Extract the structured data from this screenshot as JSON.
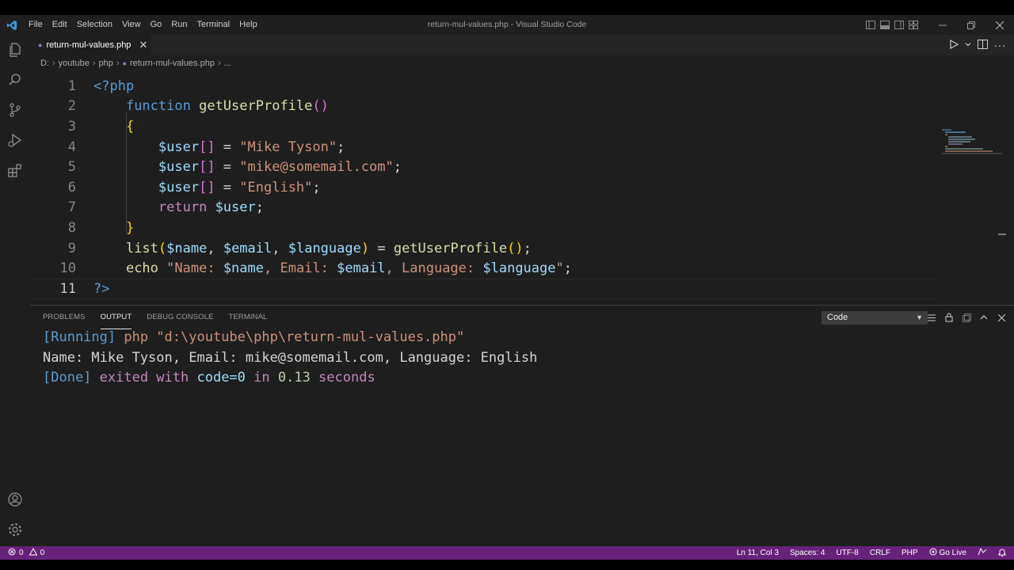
{
  "window": {
    "title": "return-mul-values.php - Visual Studio Code"
  },
  "menu": [
    "File",
    "Edit",
    "Selection",
    "View",
    "Go",
    "Run",
    "Terminal",
    "Help"
  ],
  "tab": {
    "icon": "php-file-icon",
    "label": "return-mul-values.php"
  },
  "breadcrumb": [
    "D:",
    "youtube",
    "php",
    "return-mul-values.php",
    "..."
  ],
  "editor": {
    "active_line": 11,
    "lines": [
      [
        [
          "tag",
          "<?php"
        ]
      ],
      [
        [
          "pl",
          "    "
        ],
        [
          "kw",
          "function"
        ],
        [
          "pl",
          " "
        ],
        [
          "fn",
          "getUserProfile"
        ],
        [
          "br2",
          "()"
        ]
      ],
      [
        [
          "pl",
          "    "
        ],
        [
          "br",
          "{"
        ]
      ],
      [
        [
          "pl",
          "        "
        ],
        [
          "var",
          "$user"
        ],
        [
          "br2",
          "[]"
        ],
        [
          "pl",
          " = "
        ],
        [
          "str",
          "\"Mike Tyson\""
        ],
        [
          "pl",
          ";"
        ]
      ],
      [
        [
          "pl",
          "        "
        ],
        [
          "var",
          "$user"
        ],
        [
          "br2",
          "[]"
        ],
        [
          "pl",
          " = "
        ],
        [
          "str",
          "\"mike@somemail.com\""
        ],
        [
          "pl",
          ";"
        ]
      ],
      [
        [
          "pl",
          "        "
        ],
        [
          "var",
          "$user"
        ],
        [
          "br2",
          "[]"
        ],
        [
          "pl",
          " = "
        ],
        [
          "str",
          "\"English\""
        ],
        [
          "pl",
          ";"
        ]
      ],
      [
        [
          "pl",
          "        "
        ],
        [
          "ctl",
          "return"
        ],
        [
          "pl",
          " "
        ],
        [
          "var",
          "$user"
        ],
        [
          "pl",
          ";"
        ]
      ],
      [
        [
          "pl",
          "    "
        ],
        [
          "br",
          "}"
        ]
      ],
      [
        [
          "pl",
          "    "
        ],
        [
          "fn",
          "list"
        ],
        [
          "br",
          "("
        ],
        [
          "var",
          "$name"
        ],
        [
          "pl",
          ", "
        ],
        [
          "var",
          "$email"
        ],
        [
          "pl",
          ", "
        ],
        [
          "var",
          "$language"
        ],
        [
          "br",
          ")"
        ],
        [
          "pl",
          " = "
        ],
        [
          "fn",
          "getUserProfile"
        ],
        [
          "br",
          "()"
        ],
        [
          "pl",
          ";"
        ]
      ],
      [
        [
          "pl",
          "    "
        ],
        [
          "fn",
          "echo"
        ],
        [
          "pl",
          " "
        ],
        [
          "str",
          "\"Name: "
        ],
        [
          "var",
          "$name"
        ],
        [
          "str",
          ", Email: "
        ],
        [
          "var",
          "$email"
        ],
        [
          "str",
          ", Language: "
        ],
        [
          "var",
          "$language"
        ],
        [
          "str",
          "\""
        ],
        [
          "pl",
          ";"
        ]
      ],
      [
        [
          "tag",
          "?>"
        ]
      ]
    ]
  },
  "panel": {
    "tabs": [
      "PROBLEMS",
      "OUTPUT",
      "DEBUG CONSOLE",
      "TERMINAL"
    ],
    "active_tab": "OUTPUT",
    "channel": "Code",
    "output": [
      [
        [
          "blue",
          "[Running]"
        ],
        [
          "str",
          " php \"d:\\youtube\\php\\return-mul-values.php\""
        ]
      ],
      [
        [
          "text",
          "Name: Mike Tyson, Email: mike@somemail.com, Language: English"
        ]
      ],
      [
        [
          "blue",
          "[Done]"
        ],
        [
          "kw",
          " exited with "
        ],
        [
          "code",
          "code=0"
        ],
        [
          "kw",
          " in "
        ],
        [
          "num",
          "0.13"
        ],
        [
          "kw",
          " seconds"
        ]
      ]
    ]
  },
  "status": {
    "errors": "0",
    "warnings": "0",
    "position": "Ln 11, Col 3",
    "spaces": "Spaces: 4",
    "encoding": "UTF-8",
    "eol": "CRLF",
    "language": "PHP",
    "golive": "Go Live"
  },
  "colors": {
    "status_bar": "#68217a",
    "editor_bg": "#1e1e1e",
    "accent": "#569cd6"
  }
}
